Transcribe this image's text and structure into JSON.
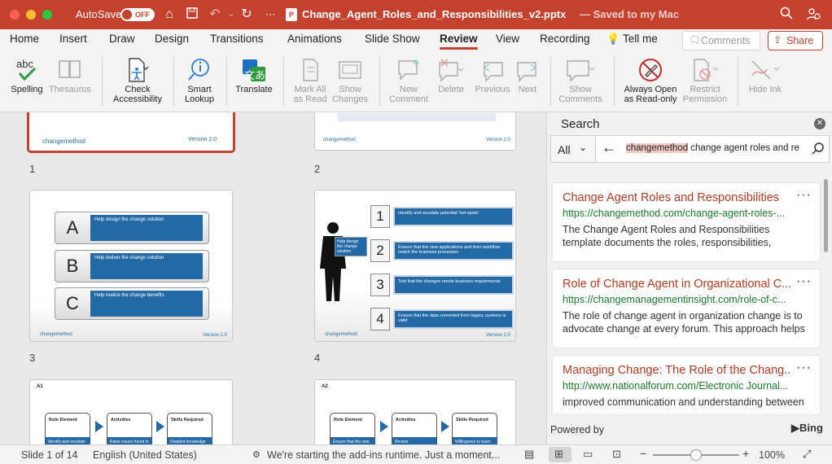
{
  "titlebar": {
    "autosave_label": "AutoSave",
    "autosave_state": "OFF",
    "filename": "Change_Agent_Roles_and_Responsibilities_v2.pptx",
    "saved_status": "— Saved to my Mac",
    "accent": "#c4412e"
  },
  "tabs": [
    "Home",
    "Insert",
    "Draw",
    "Design",
    "Transitions",
    "Animations",
    "Slide Show",
    "Review",
    "View",
    "Recording",
    "Tell me"
  ],
  "active_tab": "Review",
  "tab_buttons": {
    "comments": "Comments",
    "share": "Share"
  },
  "ribbon": {
    "spelling": "Spelling",
    "thesaurus": "Thesaurus",
    "check_accessibility_1": "Check",
    "check_accessibility_2": "Accessibility",
    "smart_lookup_1": "Smart",
    "smart_lookup_2": "Lookup",
    "translate": "Translate",
    "mark_all_1": "Mark All",
    "mark_all_2": "as Read",
    "show_changes_1": "Show",
    "show_changes_2": "Changes",
    "new_comment_1": "New",
    "new_comment_2": "Comment",
    "delete": "Delete",
    "previous": "Previous",
    "next": "Next",
    "show_comments_1": "Show",
    "show_comments_2": "Comments",
    "always_open_1": "Always Open",
    "always_open_2": "as Read-only",
    "restrict_1": "Restrict",
    "restrict_2": "Permission",
    "hide_ink": "Hide Ink",
    "abc_glyph": "abc",
    "translate_glyph": "文あ"
  },
  "slides": {
    "numbers": [
      "1",
      "2",
      "3",
      "4"
    ],
    "logo": "changemethod",
    "version1": "Version 2.0",
    "version_small": "Version 2.0",
    "s3": [
      {
        "letter": "A",
        "text": "Help design the change solution"
      },
      {
        "letter": "B",
        "text": "Help deliver the change solution"
      },
      {
        "letter": "C",
        "text": "Help realize the change benefits"
      }
    ],
    "s4_callout": "Help design the change solution",
    "s4": [
      {
        "n": "1",
        "text": "Identify and escalate potential 'hot-spots'."
      },
      {
        "n": "2",
        "text": "Ensure that the new applications and their workflow match the business processes"
      },
      {
        "n": "3",
        "text": "Test that the changes meets business requirements"
      },
      {
        "n": "4",
        "text": "Ensure that the data converted from legacy systems is valid"
      }
    ],
    "s5_tag": "A1",
    "s6_tag": "A2",
    "s5_headers": [
      "Role Element",
      "Activities",
      "Skills Required"
    ],
    "s5_cells": [
      "Identify and escalate",
      "Raise issues found in",
      "Detailed knowledge"
    ],
    "s6_headers": [
      "Role Element",
      "Activities",
      "Skills Required"
    ],
    "s6_cells": [
      "Ensure that the new",
      "Review",
      "Willingness to learn"
    ]
  },
  "search": {
    "title": "Search",
    "scope": "All",
    "query_highlight": "changemethod",
    "query_rest": " change agent roles and re",
    "powered_by": "Powered by",
    "bing": "Bing",
    "results": [
      {
        "title": "Change Agent Roles and Responsibilities",
        "url": "https://changemethod.com/change-agent-roles-...",
        "snippet": "The Change Agent Roles and Responsibilities template documents the roles, responsibilities,"
      },
      {
        "title": "Role of Change Agent in Organizational C...",
        "url": "https://changemanagementinsight.com/role-of-c...",
        "snippet": "The role of change agent in organization change is to advocate change at every forum. This approach helps"
      },
      {
        "title": "Managing Change: The Role of the Chang...",
        "url": "http://www.nationalforum.com/Electronic Journal...",
        "snippet": "improved communication and understanding between"
      }
    ]
  },
  "status": {
    "slide": "Slide 1 of 14",
    "language": "English (United States)",
    "addins": "We're starting the add-ins runtime. Just a moment...",
    "zoom": "100%",
    "zoom_level": 1.0
  }
}
